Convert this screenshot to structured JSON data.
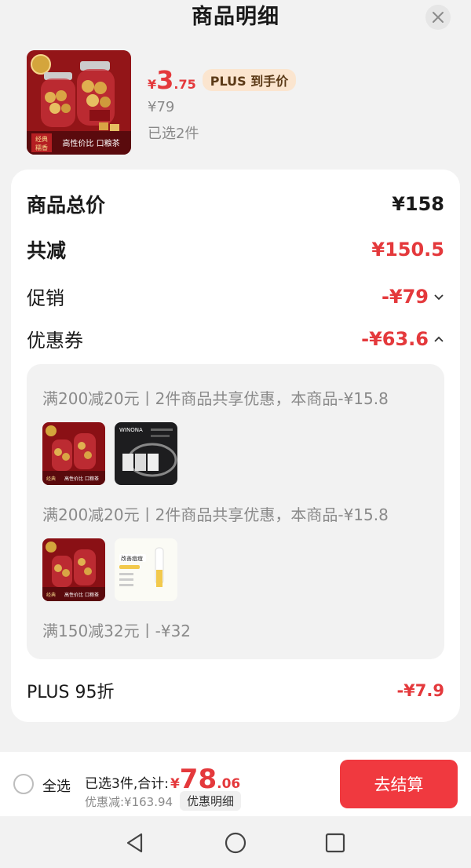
{
  "header": {
    "title": "商品明细"
  },
  "product": {
    "price_currency": "¥",
    "price_integer": "3",
    "price_decimal": ".75",
    "plus_badge": "PLUS 到手价",
    "original_price": "¥79",
    "selected_count": "已选2件",
    "image_tag_left": "经典\n糯香",
    "image_tag_right": "高性价比 口粮茶"
  },
  "summary": {
    "total_label": "商品总价",
    "total_value": "¥158",
    "reduce_label": "共减",
    "reduce_value": "¥150.5",
    "promo_label": "促销",
    "promo_value": "-¥79",
    "coupon_label": "优惠券",
    "coupon_value": "-¥63.6",
    "plus_label": "PLUS 95折",
    "plus_value": "-¥7.9"
  },
  "coupons": [
    {
      "text": "满200减20元丨2件商品共享优惠，本商品-¥15.8"
    },
    {
      "text": "满200减20元丨2件商品共享优惠，本商品-¥15.8"
    },
    {
      "text": "满150减32元丨-¥32"
    }
  ],
  "thumbs": {
    "second_brand": "WINONA",
    "third_label": "改善痘痘"
  },
  "bottom": {
    "select_all": "全选",
    "summary_prefix": "已选3件,合计:",
    "currency": "¥",
    "total_integer": "78",
    "total_decimal": ".06",
    "discount_text": "优惠减:¥163.94",
    "detail_button": "优惠明细",
    "checkout_button": "去结算"
  },
  "colors": {
    "accent_red": "#e4393c",
    "checkout_red": "#f0393f",
    "plus_badge_bg": "#fbe5cf"
  }
}
